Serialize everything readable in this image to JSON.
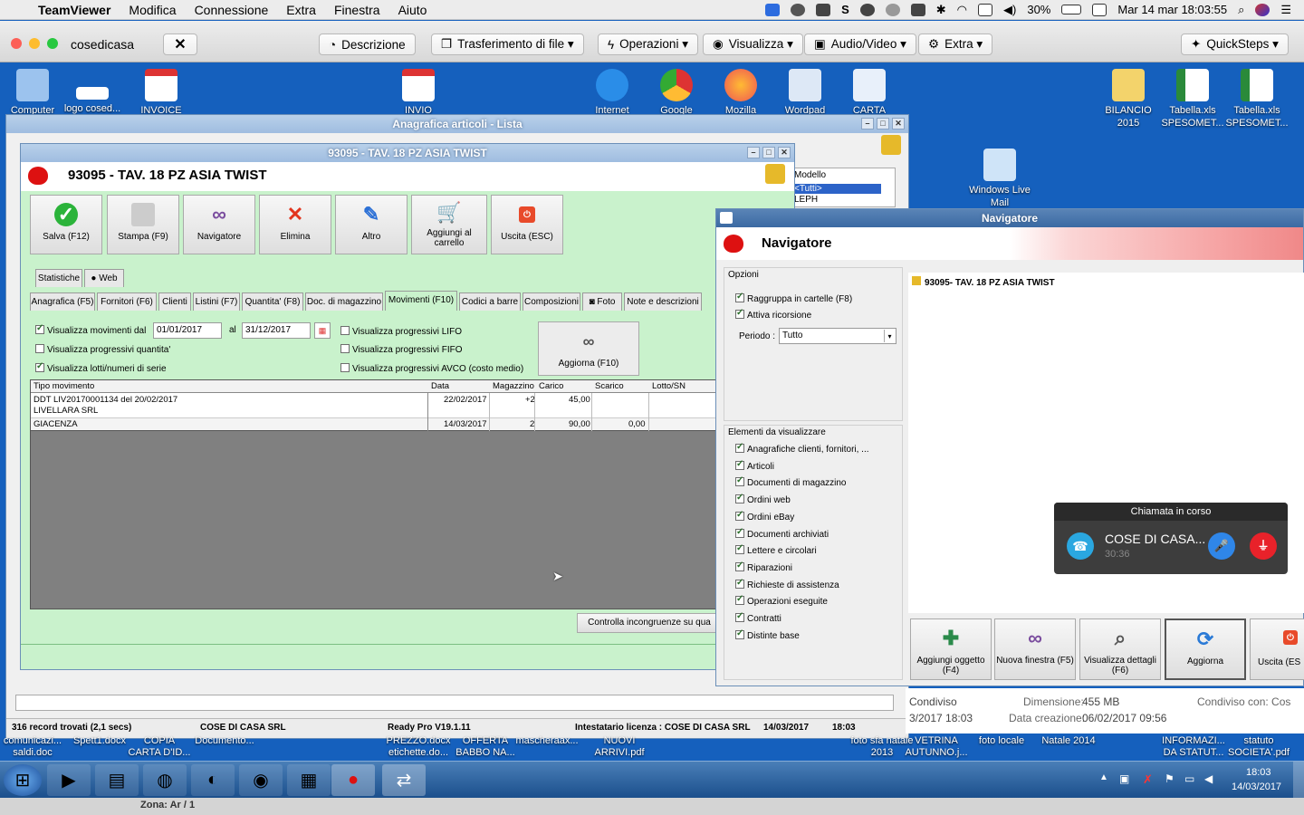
{
  "mac": {
    "app": "TeamViewer",
    "menus": [
      "Modifica",
      "Connessione",
      "Extra",
      "Finestra",
      "Aiuto"
    ],
    "battery": "30%",
    "datetime": "Mar 14 mar  18:03:55"
  },
  "tv": {
    "session": "cosedicasa",
    "buttons": [
      "Descrizione",
      "Trasferimento di file ▾",
      "Operazioni ▾",
      "Visualizza ▾",
      "Audio/Video ▾",
      "Extra ▾"
    ],
    "quicksteps": "QuickSteps ▾"
  },
  "desktop": {
    "icons": [
      "Computer",
      "logo cosed...",
      "INVOICE",
      "INVIO",
      "Internet",
      "Google",
      "Mozilla",
      "Wordpad",
      "CARTA",
      "BILANCIO 2015",
      "Tabella.xls SPESOMET...",
      "Tabella.xls SPESOMET...",
      "Windows Live Mail"
    ],
    "bottom_labels": [
      "comunicazi... saldi.doc",
      "Spett1.docx",
      "COPIA CARTA D'ID...",
      "Documento...",
      "PREZZO.docx etichette.do...",
      "OFFERTA BABBO NA...",
      "mascheraax...",
      "NUOVI ARRIVI.pdf",
      "foto sfa natale 2013",
      "VETRINA AUTUNNO.j...",
      "foto locale",
      "Natale 2014",
      "INFORMAZI... DA STATUT...",
      "statuto SOCIETA'.pdf"
    ]
  },
  "lista": {
    "title": "Anagrafica articoli  - Lista",
    "modello_label": "Modello",
    "modello_items": [
      "<Tutti>",
      "LEPH"
    ]
  },
  "articolo": {
    "title": "93095 -  TAV. 18 PZ ASIA TWIST",
    "heading": "93095 -  TAV. 18 PZ ASIA TWIST",
    "toolbar": [
      "Salva (F12)",
      "Stampa (F9)",
      "Navigatore",
      "Elimina",
      "Altro",
      "Aggiungi al carrello",
      "Uscita (ESC)"
    ],
    "tabs_top": [
      "Statistiche",
      "Web"
    ],
    "tabs": [
      "Anagrafica (F5)",
      "Fornitori (F6)",
      "Clienti",
      "Listini (F7)",
      "Quantita' (F8)",
      "Doc. di magazzino",
      "Movimenti (F10)",
      "Codici a barre",
      "Composizioni",
      "Foto",
      "Note e descrizioni"
    ],
    "opt_movimenti": "Visualizza movimenti dal",
    "date_from": "01/01/2017",
    "al": "al",
    "date_to": "31/12/2017",
    "opt_quantita": "Visualizza progressivi quantita'",
    "opt_lotti": "Visualizza lotti/numeri di serie",
    "opt_lifo": "Visualizza progressivi LIFO",
    "opt_fifo": "Visualizza progressivi FIFO",
    "opt_avco": "Visualizza progressivi AVCO (costo medio)",
    "aggiorna": "Aggiorna (F10)",
    "grid_headers": [
      "Tipo movimento",
      "Data",
      "Magazzino",
      "Carico",
      "Scarico",
      "Lotto/SN"
    ],
    "rows": [
      {
        "tipo": "DDT LIV20170001134 del 20/02/2017",
        "tipo2": "LIVELLARA SRL",
        "data": "22/02/2017",
        "mag": "+2",
        "carico": "45,00",
        "scarico": "",
        "lotto": ""
      },
      {
        "tipo": "GIACENZA",
        "tipo2": "",
        "data": "14/03/2017",
        "mag": "2",
        "carico": "90,00",
        "scarico": "0,00",
        "lotto": ""
      }
    ],
    "controlla": "Controlla incongruenze su qua"
  },
  "status": {
    "records": "316 record trovati (2,1 secs)",
    "company": "COSE DI CASA SRL",
    "version": "Ready Pro V19.1.11",
    "licenza": "Intestatario licenza : COSE DI CASA SRL",
    "date": "14/03/2017",
    "time": "18:03"
  },
  "nav": {
    "title": "Navigatore",
    "heading": "Navigatore",
    "opzioni": "Opzioni",
    "raggruppa": "Raggruppa in cartelle (F8)",
    "ricorsione": "Attiva ricorsione",
    "periodo_label": "Periodo :",
    "periodo": "Tutto",
    "elementi": "Elementi da visualizzare",
    "items": [
      "Anagrafiche clienti, fornitori, ...",
      "Articoli",
      "Documenti di magazzino",
      "Ordini web",
      "Ordini eBay",
      "Documenti archiviati",
      "Lettere e circolari",
      "Riparazioni",
      "Richieste di assistenza",
      "Operazioni eseguite",
      "Contratti",
      "Distinte base"
    ],
    "tree_item": "93095- TAV. 18 PZ ASIA TWIST",
    "buttons": [
      "Aggiungi oggetto (F4)",
      "Nuova finestra (F5)",
      "Visualizza dettagli (F6)",
      "Aggiorna",
      "Uscita (ES"
    ]
  },
  "share": {
    "condiviso": "Condiviso",
    "date": "3/2017 18:03",
    "dim_label": "Dimensione:",
    "dim": "455 MB",
    "creaz_label": "Data creazione:",
    "creaz": "06/02/2017 09:56",
    "con": "Condiviso con: Cos"
  },
  "call": {
    "header": "Chiamata in corso",
    "name": "COSE DI CASA...",
    "time": "30:36"
  },
  "taskbar": {
    "time": "18:03",
    "date": "14/03/2017",
    "zona": "Zona: Ar / 1"
  },
  "colors": {
    "accent": "#1560bd",
    "green": "#c9f2cc",
    "callbg": "#3d3d3d"
  }
}
